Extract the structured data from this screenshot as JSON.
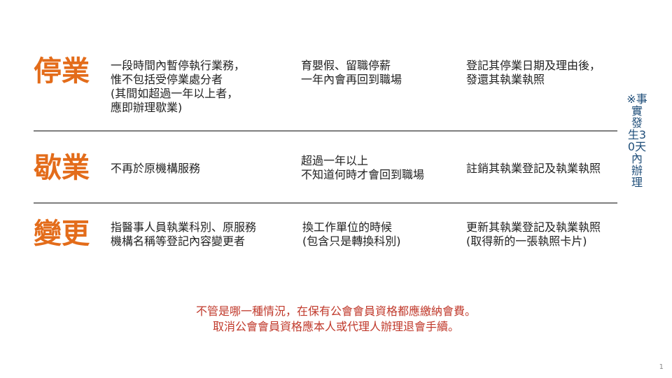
{
  "colors": {
    "title_orange": "#E36C1A",
    "divider_gray": "#7F7F7F",
    "note_red": "#C0392B",
    "side_note_blue": "#1F4E79"
  },
  "rows": [
    {
      "title": "停業",
      "definition": [
        "一段時間內暫停執行業務，",
        "惟不包括受停業處分者",
        "(其間如超過一年以上者，",
        "應即辦理歇業)"
      ],
      "example": [
        "育嬰假、留職停薪",
        "一年內會再回到職場"
      ],
      "action": [
        "登記其停業日期及理由後，",
        "發還其執業執照"
      ]
    },
    {
      "title": "歇業",
      "definition": [
        "不再於原機構服務"
      ],
      "example": [
        "超過一年以上",
        "不知道何時才會回到職場"
      ],
      "action": [
        "註銷其執業登記及執業執照"
      ]
    },
    {
      "title": "變更",
      "definition": [
        "指醫事人員執業科別、原服務",
        "機構名稱等登記內容變更者"
      ],
      "example": [
        "換工作單位的時候",
        "(包含只是轉換科別)"
      ],
      "action": [
        "更新其執業登記及執業執照",
        "(取得新的一張執照卡片)"
      ]
    }
  ],
  "side_note": "※事實發生30天內辦理",
  "footer": {
    "line1": "不管是哪一種情況，在保有公會會員資格都應繳納會費。",
    "line2": "取消公會會員資格應本人或代理人辦理退會手續。"
  },
  "page_number": "1"
}
